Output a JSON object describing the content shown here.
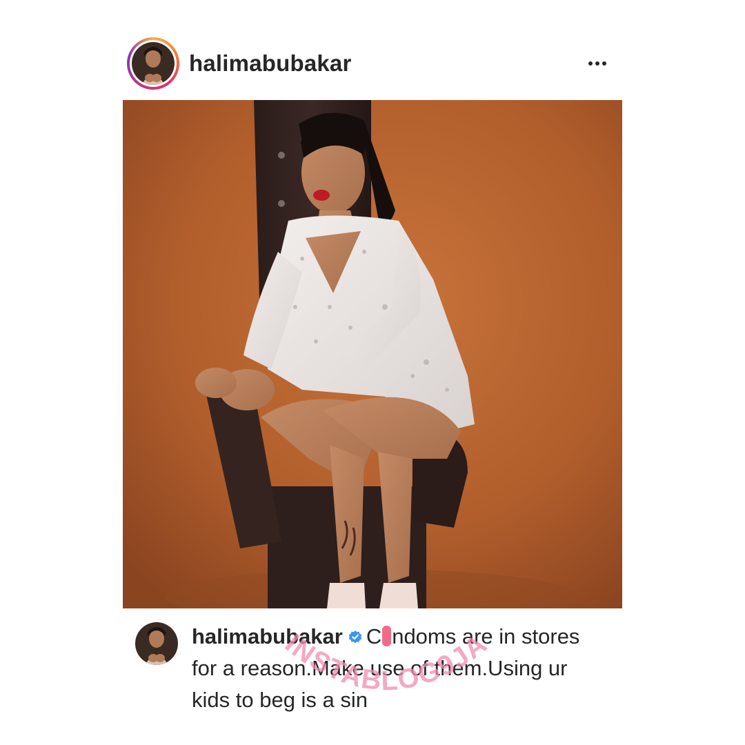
{
  "post": {
    "username": "halimabubakar",
    "more_label": "•••",
    "verified": true,
    "caption": {
      "username": "halimabubakar",
      "text_before_mark": "C",
      "text_after_mark": "ndoms are in stores for a reason.Make use of them.Using ur kids to beg is a sin"
    }
  },
  "icons": {
    "more": "more-options-icon",
    "verified": "verified-badge-icon",
    "watermark": "instablog9ja-watermark"
  },
  "colors": {
    "text": "#262626",
    "verified_blue": "#3897f0",
    "photo_background": "#b8622e",
    "watermark_pink": "#f28bb0",
    "redaction_pink": "#f06a8a"
  },
  "watermark_text": "INSTABLOG9JA"
}
